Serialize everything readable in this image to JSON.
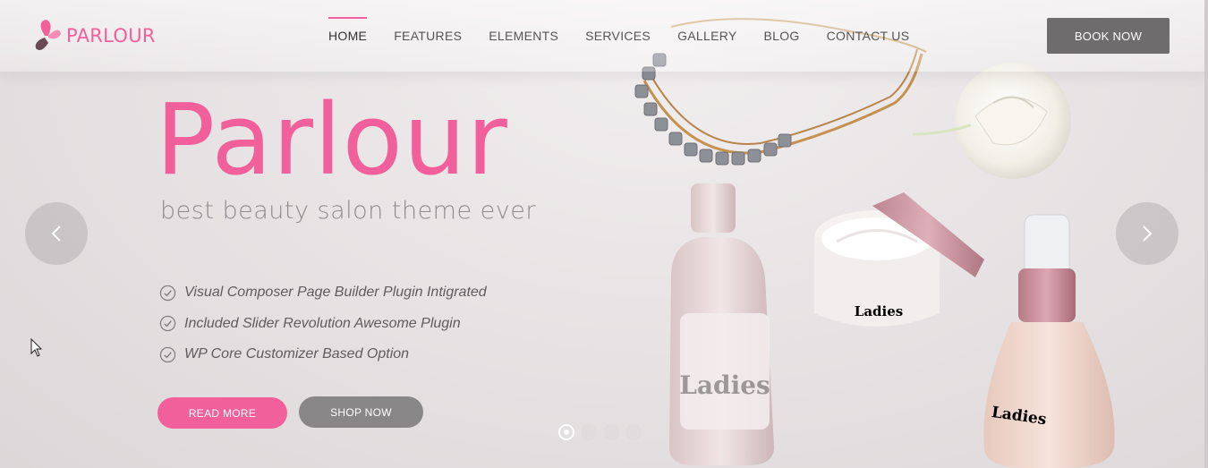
{
  "brand": {
    "name": "PARLOUR"
  },
  "nav": {
    "items": [
      {
        "label": "HOME",
        "active": true
      },
      {
        "label": "FEATURES",
        "active": false
      },
      {
        "label": "ELEMENTS",
        "active": false
      },
      {
        "label": "SERVICES",
        "active": false
      },
      {
        "label": "GALLERY",
        "active": false
      },
      {
        "label": "BLOG",
        "active": false
      },
      {
        "label": "CONTACT US",
        "active": false
      }
    ],
    "book_label": "BOOK NOW"
  },
  "hero": {
    "title": "Parlour",
    "subtitle": "best beauty salon theme ever",
    "features": [
      "Visual Composer Page Builder Plugin Intigrated",
      "Included Slider Revolution Awesome Plugin",
      "WP Core Customizer Based Option"
    ],
    "read_more_label": "READ MORE",
    "shop_now_label": "SHOP NOW",
    "product_brand": "Ladies"
  },
  "slider": {
    "slide_count": 4,
    "active_slide": 1
  },
  "icons": {
    "logo": "butterfly-logo-icon",
    "feature": "check-circle-icon",
    "prev": "chevron-left-icon",
    "next": "chevron-right-icon"
  },
  "colors": {
    "accent": "#f1609b",
    "button_dark": "#6e6c6d",
    "button_gray": "#888687",
    "text_gray": "#8e8c8e"
  }
}
